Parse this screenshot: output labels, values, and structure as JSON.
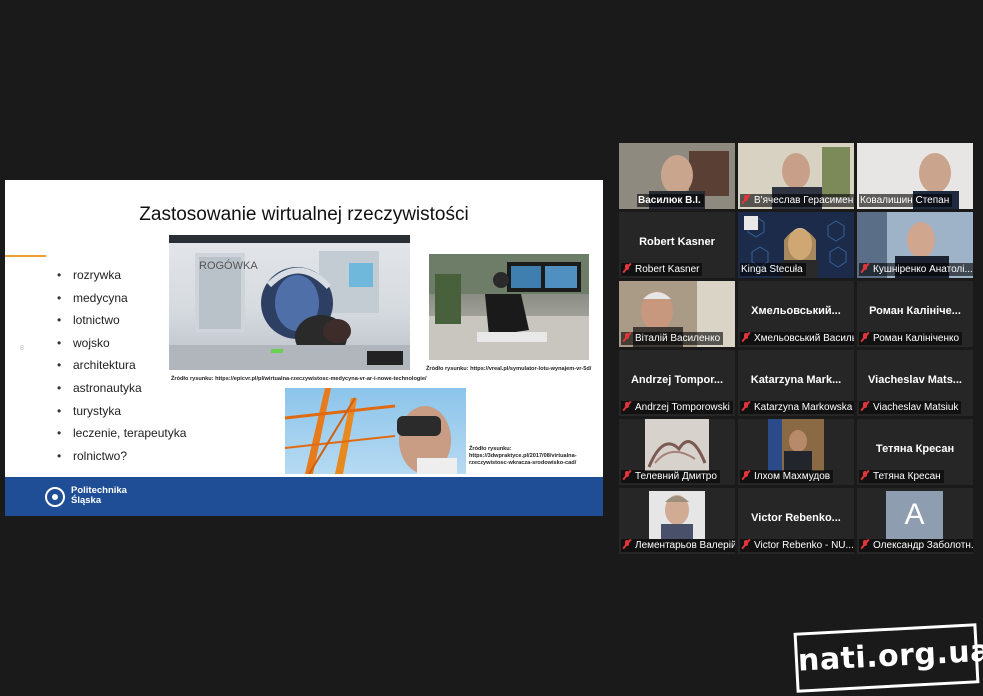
{
  "slide": {
    "title": "Zastosowanie wirtualnej rzeczywistości",
    "bullets": [
      "rozrywka",
      "medycyna",
      "lotnictwo",
      "wojsko",
      "architektura",
      "astronautyka",
      "turystyka",
      "leczenie, terapeutyka",
      "rolnictwo?"
    ],
    "images": {
      "vr_surgery": {
        "caption": "Źródło rysunku: https://epicvr.pl/pl/wirtualna-rzeczywistosc-medycyna-vr-ar-i-nowe-technologie/",
        "sign_text": "ROGÓWKA"
      },
      "flight_sim": {
        "caption": "Źródło rysunku: https://vreal.pl/symulator-lotu-wynajem-vr-5d/"
      },
      "crane_vr": {
        "caption": "Źródło rysunku: https://3dwpraktyce.pl/2017/08/virtualna-rzeczywistosc-wkracza-srodowisko-cad/"
      }
    },
    "footer": {
      "logo_line1": "Politechnika",
      "logo_line2": "Śląska",
      "color": "#1f4e96"
    }
  },
  "participants": [
    {
      "label": "Василюк В.І."
    },
    {
      "label": "В'ячеслав Герасимен..."
    },
    {
      "label": "Ковалишин Степан"
    },
    {
      "label": "Robert Kasner",
      "big_name": "Robert Kasner"
    },
    {
      "label": "Kinga Stecuła",
      "active": true
    },
    {
      "label": "Кушніренко Анатолі..."
    },
    {
      "label": "Віталій Василенко"
    },
    {
      "label": "Хмельовський Василь",
      "big_name": "Хмельовський..."
    },
    {
      "label": "Роман Калініченко",
      "big_name": "Роман Калініче..."
    },
    {
      "label": "Andrzej Tomporowski",
      "big_name": "Andrzej  Tompor..."
    },
    {
      "label": "Katarzyna Markowska",
      "big_name": "Katarzyna  Mark..."
    },
    {
      "label": "Viacheslav Matsiuk",
      "big_name": "Viacheslav  Mats..."
    },
    {
      "label": "Телевний Дмитро"
    },
    {
      "label": "Ілхом Махмудов"
    },
    {
      "label": "Тетяна Кресан",
      "big_name": "Тетяна Кресан"
    },
    {
      "label": "Лементарьов Валерій"
    },
    {
      "label": "Victor Rebenko - NU...",
      "big_name": "Victor  Rebenko..."
    },
    {
      "label": "Олександр Заболотн...",
      "avatar_letter": "A"
    }
  ],
  "watermark": {
    "text": "nati.org.ua"
  }
}
